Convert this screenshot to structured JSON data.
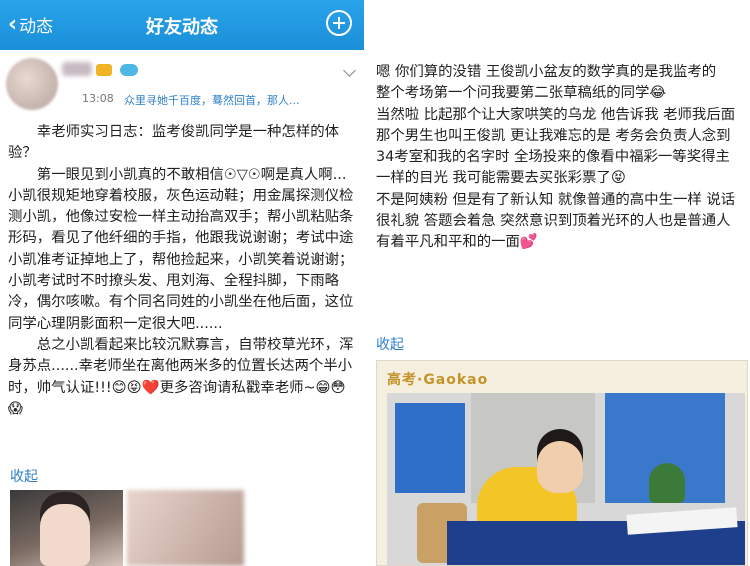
{
  "left": {
    "header": {
      "back_label": "动态",
      "title": "好友动态"
    },
    "post_meta": {
      "time": "13:08",
      "signature": "众里寻她千百度，蓦然回首，那人..."
    },
    "post_paragraphs": [
      "幸老师实习日志：监考俊凯同学是一种怎样的体验？",
      "第一眼见到小凯真的不敢相信☉▽☉啊是真人啊...小凯很规矩地穿着校服，灰色运动鞋；用金属探测仪检测小凯，他像过安检一样主动抬高双手；帮小凯粘贴条形码，看见了他纤细的手指，他跟我说谢谢；考试中途小凯准考证掉地上了，帮他捡起来，小凯笑着说谢谢；小凯考试时不时撩头发、甩刘海、全程抖脚，下雨略冷，偶尔咳嗽。有个同名同姓的小凯坐在他后面，这位同学心理阴影面积一定很大吧......",
      "总之小凯看起来比较沉默寡言，自带校草光环，浑身苏点......幸老师坐在离他两米多的位置长达两个半小时，帅气认证!!!😊😝❤️更多咨询请私戳幸老师~😁😳😱"
    ],
    "collapse_label": "收起"
  },
  "right": {
    "paragraphs": [
      "嗯 你们算的没错 王俊凯小盆友的数学真的是我监考的",
      "整个考场第一个问我要第二张草稿纸的同学😂",
      "当然啦 比起那个让大家哄笑的乌龙 他告诉我 老师我后面那个男生也叫王俊凯 更让我难忘的是 考务会负责人念到34考室和我的名字时 全场投来的像看中福彩一等奖得主一样的目光 我可能需要去买张彩票了😝",
      "不是阿姨粉 但是有了新认知 就像普通的高中生一样 说话很礼貌 答题会着急 突然意识到顶着光环的人也是普通人 有着平凡和平和的一面💕"
    ],
    "collapse_label": "收起",
    "photo_caption": "高考·Gaokao"
  }
}
